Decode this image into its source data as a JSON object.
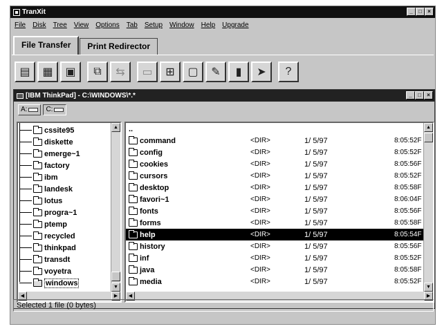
{
  "window": {
    "title": "TranXit",
    "controls": [
      "_",
      "□",
      "×"
    ]
  },
  "menu": [
    "File",
    "Disk",
    "Tree",
    "View",
    "Options",
    "Tab",
    "Setup",
    "Window",
    "Help",
    "Upgrade"
  ],
  "tabs": [
    {
      "label": "File Transfer",
      "active": true
    },
    {
      "label": "Print Redirector",
      "active": false
    }
  ],
  "toolbar": [
    {
      "icon": "copy-file-icon",
      "glyph": "▤"
    },
    {
      "icon": "edit-file-icon",
      "glyph": "▦"
    },
    {
      "icon": "save-disk-icon",
      "glyph": "▣"
    },
    {
      "icon": "connect-icon",
      "glyph": "⧉"
    },
    {
      "icon": "transfer-icon",
      "glyph": "⇆"
    },
    {
      "icon": "compare-icon",
      "glyph": "▭"
    },
    {
      "icon": "sync-folders-icon",
      "glyph": "⊞"
    },
    {
      "icon": "screen-icon",
      "glyph": "▢"
    },
    {
      "icon": "pen-icon",
      "glyph": "✎"
    },
    {
      "icon": "device-icon",
      "glyph": "▮"
    },
    {
      "icon": "run-icon",
      "glyph": "➤"
    },
    {
      "icon": "help-icon",
      "glyph": "?"
    }
  ],
  "child": {
    "title": "[IBM ThinkPad] - C:\\WINDOWS\\*.*",
    "drives": [
      {
        "label": "A:",
        "selected": false
      },
      {
        "label": "C:",
        "selected": true
      }
    ]
  },
  "tree": [
    "cssite95",
    "diskette",
    "emerge~1",
    "factory",
    "ibm",
    "landesk",
    "lotus",
    "progra~1",
    "ptemp",
    "recycled",
    "thinkpad",
    "transdt",
    "voyetra",
    "windows"
  ],
  "tree_current": "windows",
  "files": [
    {
      "name": "..",
      "type": "",
      "date": "",
      "time": ""
    },
    {
      "name": "command",
      "type": "<DIR>",
      "date": "1/ 5/97",
      "time": "8:05:52F"
    },
    {
      "name": "config",
      "type": "<DIR>",
      "date": "1/ 5/97",
      "time": "8:05:52F"
    },
    {
      "name": "cookies",
      "type": "<DIR>",
      "date": "1/ 5/97",
      "time": "8:05:56F"
    },
    {
      "name": "cursors",
      "type": "<DIR>",
      "date": "1/ 5/97",
      "time": "8:05:52F"
    },
    {
      "name": "desktop",
      "type": "<DIR>",
      "date": "1/ 5/97",
      "time": "8:05:58F"
    },
    {
      "name": "favori~1",
      "type": "<DIR>",
      "date": "1/ 5/97",
      "time": "8:06:04F"
    },
    {
      "name": "fonts",
      "type": "<DIR>",
      "date": "1/ 5/97",
      "time": "8:05:56F"
    },
    {
      "name": "forms",
      "type": "<DIR>",
      "date": "1/ 5/97",
      "time": "8:05:58F"
    },
    {
      "name": "help",
      "type": "<DIR>",
      "date": "1/ 5/97",
      "time": "8:05:54F"
    },
    {
      "name": "history",
      "type": "<DIR>",
      "date": "1/ 5/97",
      "time": "8:05:56F"
    },
    {
      "name": "inf",
      "type": "<DIR>",
      "date": "1/ 5/97",
      "time": "8:05:52F"
    },
    {
      "name": "java",
      "type": "<DIR>",
      "date": "1/ 5/97",
      "time": "8:05:58F"
    },
    {
      "name": "media",
      "type": "<DIR>",
      "date": "1/ 5/97",
      "time": "8:05:52F"
    }
  ],
  "selected_file": "help",
  "status": "Selected 1 file  (0 bytes)"
}
